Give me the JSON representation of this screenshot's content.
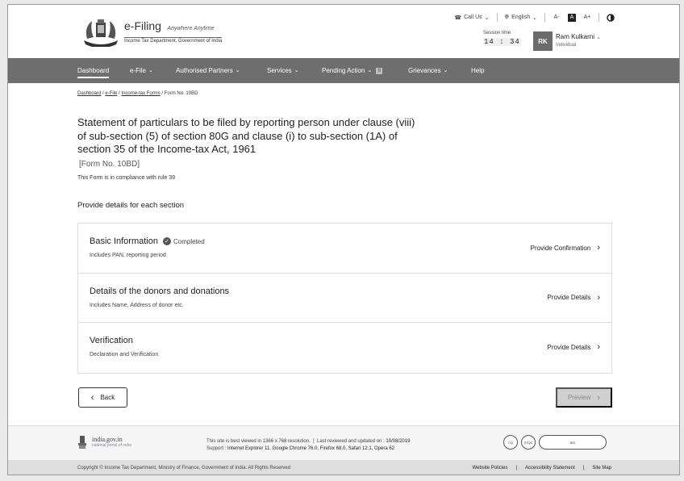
{
  "header": {
    "brand_title": "e-Filing",
    "brand_tagline": "Anywhere Anytime",
    "brand_sub": "Income Tax Department, Government of India",
    "call_us": "Call Us",
    "language": "English",
    "font_decrease": "A-",
    "font_reset": "A",
    "font_increase": "A+",
    "session_label": "Session time",
    "session_time": "14 : 34",
    "avatar_initials": "RK",
    "user_name": "Ram Kulkarni",
    "user_role": "Individual"
  },
  "nav": {
    "items": [
      {
        "label": "Dashboard"
      },
      {
        "label": "e-File"
      },
      {
        "label": "Authorised Partners"
      },
      {
        "label": "Services"
      },
      {
        "label": "Pending Action"
      },
      {
        "label": "Grievances"
      },
      {
        "label": "Help"
      }
    ],
    "pending_badge": "8"
  },
  "breadcrumb": {
    "dashboard": "Dashboard",
    "efile": "e-File",
    "forms": "Income-tax Forms",
    "current": "Form No. 10BD"
  },
  "page": {
    "title": "Statement of particulars to be filed by reporting person under clause (viii) of sub-section (5) of section 80G and clause (i) to sub-section (1A) of section 35 of the Income-tax Act, 1961",
    "form_no": "[Form No. 10BD]",
    "compliance": "This Form is in compliance with rule 39",
    "section_heading": "Provide details for each section"
  },
  "sections": [
    {
      "title": "Basic Information",
      "status": "Completed",
      "subtitle": "Includes PAN, reporting period",
      "action": "Provide Confirmation"
    },
    {
      "title": "Details of the donors and donations",
      "status": "",
      "subtitle": "Includes Name, Address of donor etc.",
      "action": "Provide Details"
    },
    {
      "title": "Verification",
      "status": "",
      "subtitle": "Declaration and Verification",
      "action": "Provide Details"
    }
  ],
  "buttons": {
    "back": "Back",
    "preview": "Preview"
  },
  "footer": {
    "gov_main": "india.gov.in",
    "gov_sub": "national portal of india",
    "resolution_text": "This site is best viewed in 1366 x 768 resolution.",
    "last_reviewed_label": "Last reviewed and updated on :",
    "last_reviewed_date": "10/08/2019",
    "support_label": "Support :",
    "support_browsers": "Internet Explorer 11, Google Chrome 76.0,  Firefox 68.0, Safari 12.1, Opera 62",
    "copyright": "Copyright © Income Tax Department, Ministry of Finance, Government of India. All Rights Reserved",
    "links": [
      "Website Policies",
      "Accessibility Statement",
      "Site Map"
    ]
  }
}
